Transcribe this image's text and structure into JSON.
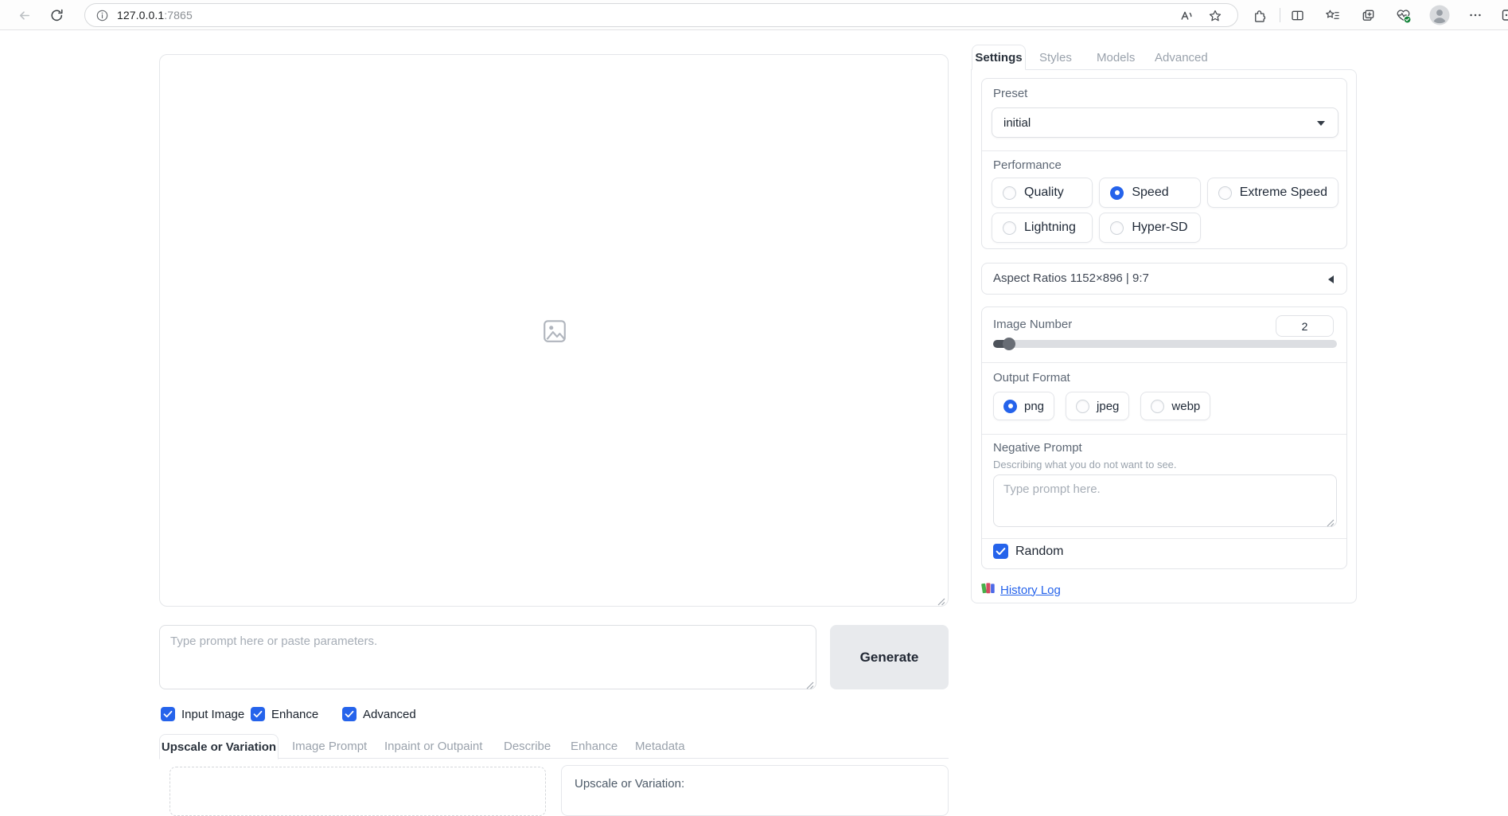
{
  "browser": {
    "url_host": "127.0.0.1",
    "url_port": ":7865"
  },
  "settings_panel": {
    "tabs": {
      "settings": "Settings",
      "styles": "Styles",
      "models": "Models",
      "advanced": "Advanced"
    },
    "preset_label": "Preset",
    "preset_value": "initial",
    "performance_label": "Performance",
    "perf_options": {
      "quality": "Quality",
      "speed": "Speed",
      "extreme": "Extreme Speed",
      "lightning": "Lightning",
      "hyper": "Hyper-SD"
    },
    "perf_selected": "Speed",
    "aspect_label": "Aspect Ratios 1152×896 | 9:7",
    "image_number_label": "Image Number",
    "image_number_value": "2",
    "output_format_label": "Output Format",
    "format_options": {
      "png": "png",
      "jpeg": "jpeg",
      "webp": "webp"
    },
    "format_selected": "png",
    "negative_prompt_label": "Negative Prompt",
    "negative_prompt_info": "Describing what you do not want to see.",
    "negative_prompt_placeholder": "Type prompt here.",
    "random_label": "Random",
    "random_checked": true,
    "history_log_label": "History Log"
  },
  "main": {
    "prompt_placeholder": "Type prompt here or paste parameters.",
    "generate_label": "Generate",
    "checkbox_input_image": "Input Image",
    "checkbox_enhance": "Enhance",
    "checkbox_advanced": "Advanced",
    "checkboxes_checked": true,
    "tool_tabs": {
      "uov": "Upscale or Variation",
      "image_prompt": "Image Prompt",
      "inpaint": "Inpaint or Outpaint",
      "describe": "Describe",
      "enhance": "Enhance",
      "metadata": "Metadata"
    },
    "uov_panel_label": "Upscale or Variation:"
  }
}
